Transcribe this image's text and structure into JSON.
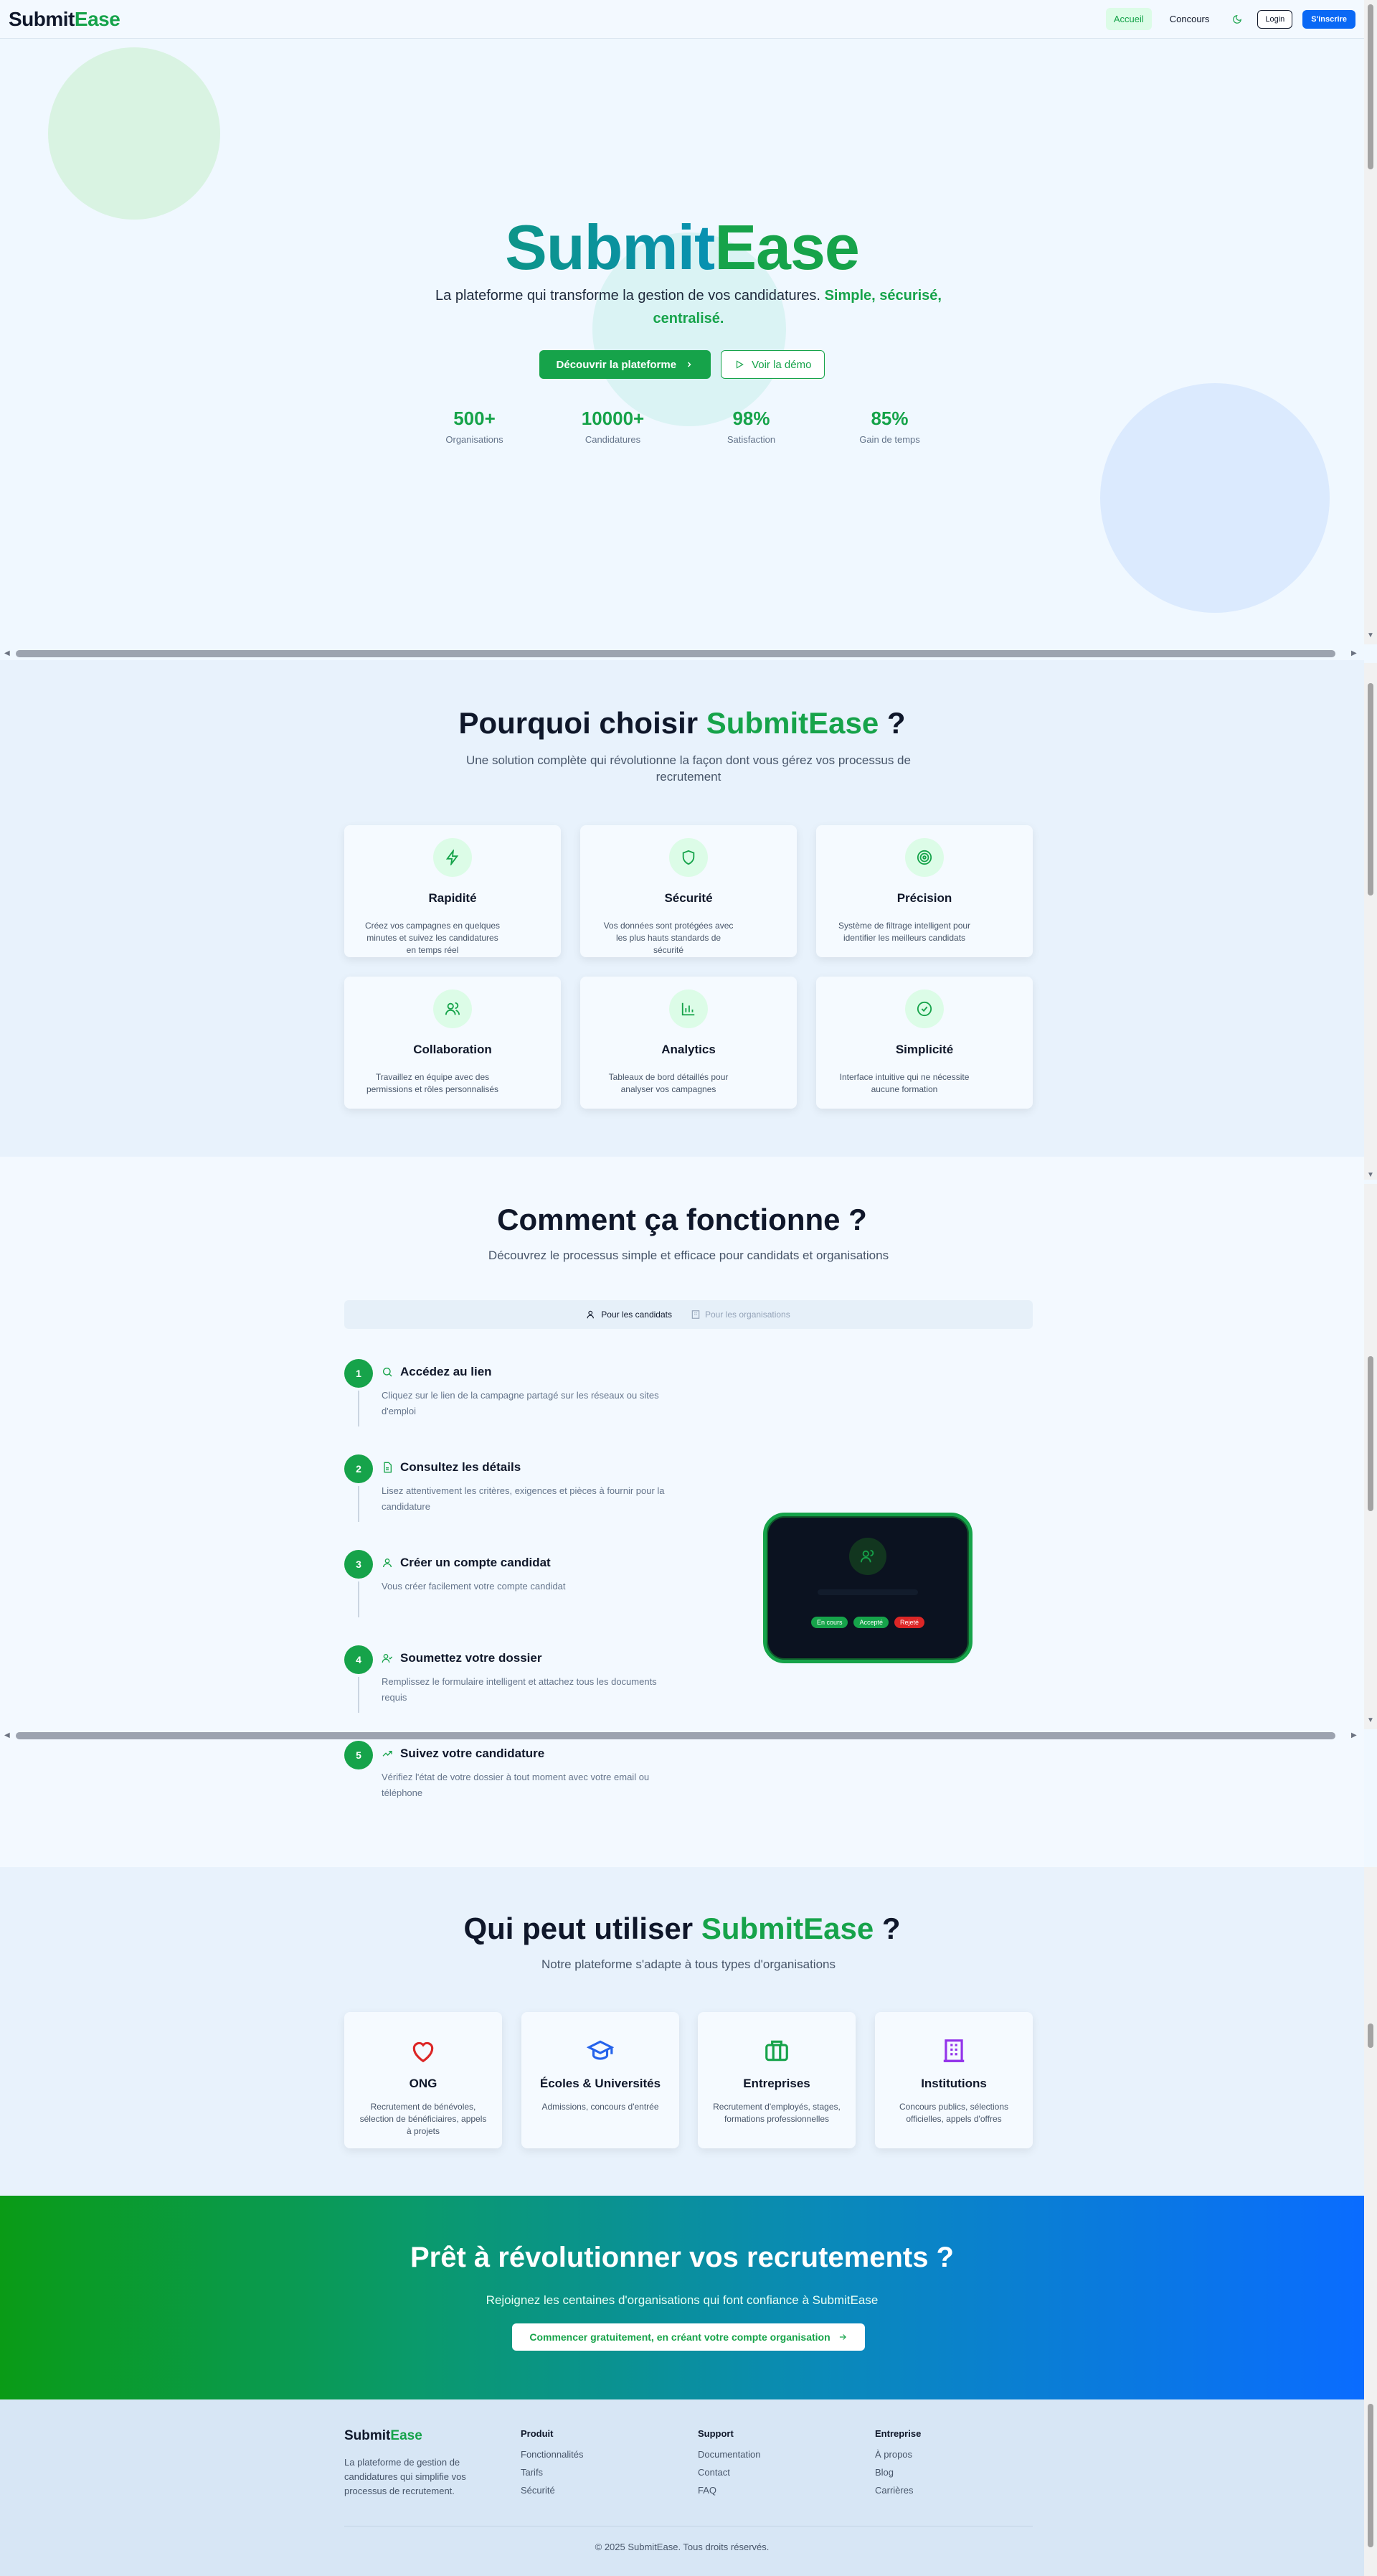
{
  "header": {
    "logo_a": "Submit",
    "logo_b": "Ease",
    "nav": [
      "Accueil",
      "Concours"
    ],
    "login": "Login",
    "signup": "S'inscrire"
  },
  "hero": {
    "title_a": "Submit",
    "title_b": "Ease",
    "subtitle_a": "La plateforme qui transforme la gestion de vos candidatures.",
    "subtitle_b": "Simple, sécurisé, centralisé.",
    "primary_cta": "Découvrir la plateforme",
    "secondary_cta": "Voir la démo",
    "stats": [
      {
        "value": "500+",
        "label": "Organisations"
      },
      {
        "value": "10000+",
        "label": "Candidatures"
      },
      {
        "value": "98%",
        "label": "Satisfaction"
      },
      {
        "value": "85%",
        "label": "Gain de temps"
      }
    ]
  },
  "why": {
    "title_a": "Pourquoi choisir",
    "title_b": "SubmitEase",
    "title_c": "?",
    "subtitle": "Une solution complète qui révolutionne la façon dont vous gérez vos processus de recrutement",
    "features": [
      {
        "icon": "zap-icon",
        "title": "Rapidité",
        "desc": "Créez vos campagnes en quelques minutes et suivez les candidatures en temps réel"
      },
      {
        "icon": "shield-icon",
        "title": "Sécurité",
        "desc": "Vos données sont protégées avec les plus hauts standards de sécurité"
      },
      {
        "icon": "target-icon",
        "title": "Précision",
        "desc": "Système de filtrage intelligent pour identifier les meilleurs candidats"
      },
      {
        "icon": "users-icon",
        "title": "Collaboration",
        "desc": "Travaillez en équipe avec des permissions et rôles personnalisés"
      },
      {
        "icon": "bar-chart-icon",
        "title": "Analytics",
        "desc": "Tableaux de bord détaillés pour analyser vos campagnes"
      },
      {
        "icon": "check-circle-icon",
        "title": "Simplicité",
        "desc": "Interface intuitive qui ne nécessite aucune formation"
      }
    ]
  },
  "how": {
    "title": "Comment ça fonctionne ?",
    "subtitle": "Découvrez le processus simple et efficace pour candidats et organisations",
    "tab_candidates": "Pour les candidats",
    "tab_orgs": "Pour les organisations",
    "steps": [
      {
        "n": "1",
        "icon": "search-icon",
        "title": "Accédez au lien",
        "desc": "Cliquez sur le lien de la campagne partagé sur les réseaux ou sites d'emploi"
      },
      {
        "n": "2",
        "icon": "file-icon",
        "title": "Consultez les détails",
        "desc": "Lisez attentivement les critères, exigences et pièces à fournir pour la candidature"
      },
      {
        "n": "3",
        "icon": "user-icon",
        "title": "Créer un compte candidat",
        "desc": "Vous créer facilement votre compte candidat"
      },
      {
        "n": "4",
        "icon": "user-check-icon",
        "title": "Soumettez votre dossier",
        "desc": "Remplissez le formulaire intelligent et attachez tous les documents requis"
      },
      {
        "n": "5",
        "icon": "trending-up-icon",
        "title": "Suivez votre candidature",
        "desc": "Vérifiez l'état de votre dossier à tout moment avec votre email ou téléphone"
      }
    ],
    "phone_pills": [
      "En cours",
      "Accepté",
      "Rejeté"
    ]
  },
  "who": {
    "title_a": "Qui peut utiliser",
    "title_b": "SubmitEase",
    "title_c": "?",
    "subtitle": "Notre plateforme s'adapte à tous types d'organisations",
    "orgs": [
      {
        "icon": "heart-icon",
        "color": "#dc2626",
        "title": "ONG",
        "desc": "Recrutement de bénévoles, sélection de bénéficiaires, appels à projets"
      },
      {
        "icon": "graduation-cap-icon",
        "color": "#2563eb",
        "title": "Écoles & Universités",
        "desc": "Admissions, concours d'entrée"
      },
      {
        "icon": "briefcase-icon",
        "color": "#16a34a",
        "title": "Entreprises",
        "desc": "Recrutement d'employés, stages, formations professionnelles"
      },
      {
        "icon": "building-icon",
        "color": "#9333ea",
        "title": "Institutions",
        "desc": "Concours publics, sélections officielles, appels d'offres"
      }
    ]
  },
  "cta": {
    "title": "Prêt à révolutionner vos recrutements ?",
    "subtitle": "Rejoignez les centaines d'organisations qui font confiance à SubmitEase",
    "button": "Commencer gratuitement, en créant votre compte organisation"
  },
  "footer": {
    "logo_a": "Submit",
    "logo_b": "Ease",
    "desc": "La plateforme de gestion de candidatures qui simplifie vos processus de recrutement.",
    "cols": [
      {
        "head": "Produit",
        "links": [
          "Fonctionnalités",
          "Tarifs",
          "Sécurité"
        ]
      },
      {
        "head": "Support",
        "links": [
          "Documentation",
          "Contact",
          "FAQ"
        ]
      },
      {
        "head": "Entreprise",
        "links": [
          "À propos",
          "Blog",
          "Carrières"
        ]
      }
    ],
    "copyright": "© 2025 SubmitEase. Tous droits réservés."
  },
  "colors": {
    "brand_green": "#16a34a",
    "brand_blue": "#0a68f5",
    "teal": "#0d9488"
  }
}
